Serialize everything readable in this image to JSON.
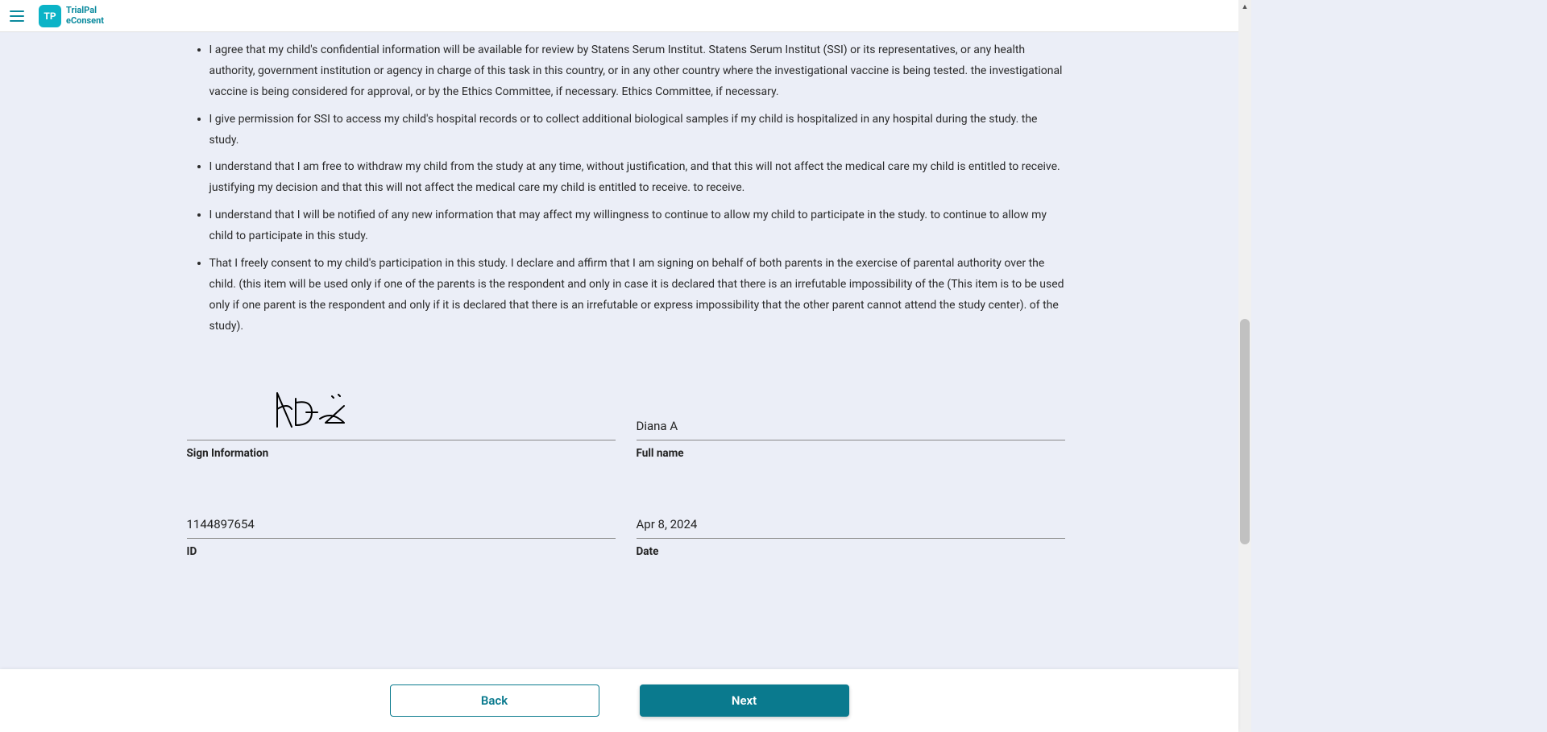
{
  "header": {
    "logo_text": "TP",
    "brand_line1": "TrialPal",
    "brand_line2": "eConsent"
  },
  "consent_items": [
    "I agree that my child's confidential information will be available for review by Statens Serum Institut. Statens Serum Institut (SSI) or its representatives, or any health authority, government institution or agency in charge of this task in this country, or in any other country where the investigational vaccine is being tested. the investigational vaccine is being considered for approval, or by the Ethics Committee, if necessary. Ethics Committee, if necessary.",
    "I give permission for SSI to access my child's hospital records or to collect additional biological samples if my child is hospitalized in any hospital during the study. the study.",
    "I understand that I am free to withdraw my child from the study at any time, without justification, and that this will not affect the medical care my child is entitled to receive. justifying my decision and that this will not affect the medical care my child is entitled to receive. to receive.",
    "I understand that I will be notified of any new information that may affect my willingness to continue to allow my child to participate in the study. to continue to allow my child to participate in this study.",
    "That I freely consent to my child's participation in this study. I declare and affirm that I am signing on behalf of both parents in the exercise of parental authority over the child. (this item will be used only if one of the parents is the respondent and only in case it is declared that there is an irrefutable impossibility of the (This item is to be used only if one parent is the respondent and only if it is declared that there is an irrefutable or express impossibility that the other parent cannot attend the study center). of the study)."
  ],
  "signature": {
    "sign_info_label": "Sign Information",
    "fullname_label": "Full name",
    "fullname_value": "Diana A",
    "id_label": "ID",
    "id_value": "1144897654",
    "date_label": "Date",
    "date_value": "Apr 8, 2024"
  },
  "footer": {
    "back_label": "Back",
    "next_label": "Next"
  }
}
